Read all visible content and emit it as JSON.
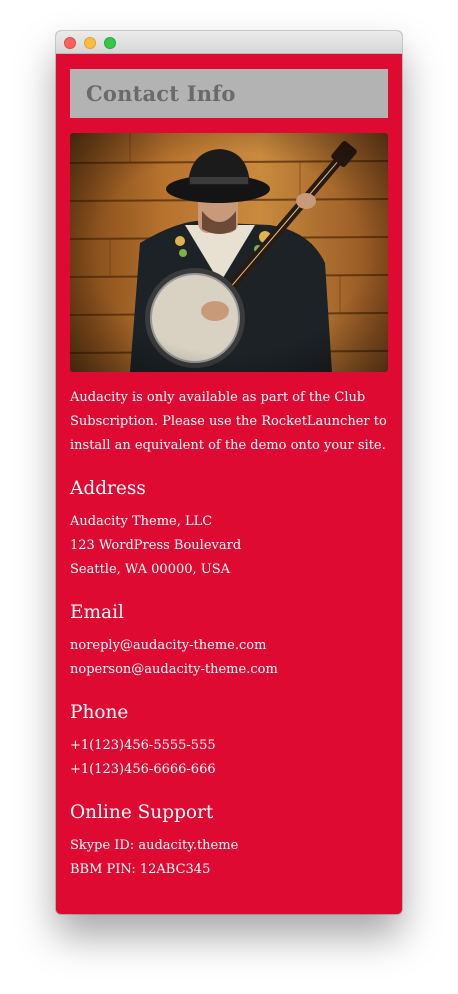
{
  "window": {
    "controls": [
      "close",
      "minimize",
      "zoom"
    ]
  },
  "header": {
    "title": "Contact Info"
  },
  "image": {
    "description": "musician-with-banjo-photo"
  },
  "intro_text": "Audacity is only available as part of the Club Subscription. Please use the RocketLauncher to install an equivalent of the demo onto your site.",
  "sections": {
    "address": {
      "title": "Address",
      "lines": [
        "Audacity Theme, LLC",
        "123 WordPress Boulevard",
        "Seattle, WA 00000, USA"
      ]
    },
    "email": {
      "title": "Email",
      "lines": [
        "noreply@audacity-theme.com",
        "noperson@audacity-theme.com"
      ]
    },
    "phone": {
      "title": "Phone",
      "lines": [
        "+1(123)456-5555-555",
        "+1(123)456-6666-666"
      ]
    },
    "support": {
      "title": "Online Support",
      "lines": [
        "Skype ID: audacity.theme",
        "BBM PIN: 12ABC345"
      ]
    }
  },
  "colors": {
    "background": "#df0a32",
    "header_box": "#b3b3b3",
    "header_text": "#6a6a6a",
    "text": "#ffffff"
  }
}
